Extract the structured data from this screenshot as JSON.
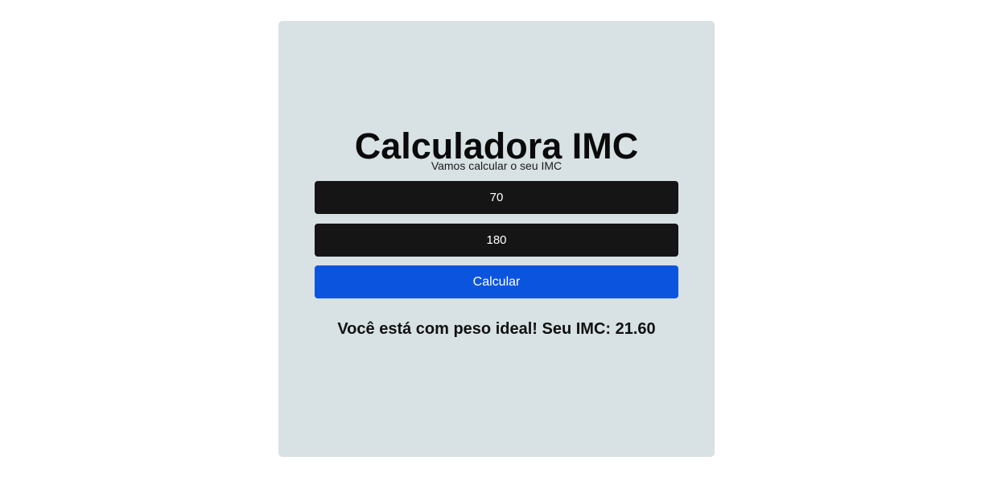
{
  "calculator": {
    "title": "Calculadora IMC",
    "subtitle": "Vamos calcular o seu IMC",
    "weight_value": "70",
    "height_value": "180",
    "button_label": "Calcular",
    "result_text": "Você está com peso ideal! Seu IMC: 21.60"
  },
  "colors": {
    "card_background": "#d8e1e3",
    "input_background": "#151515",
    "button_background": "#0b55de"
  }
}
